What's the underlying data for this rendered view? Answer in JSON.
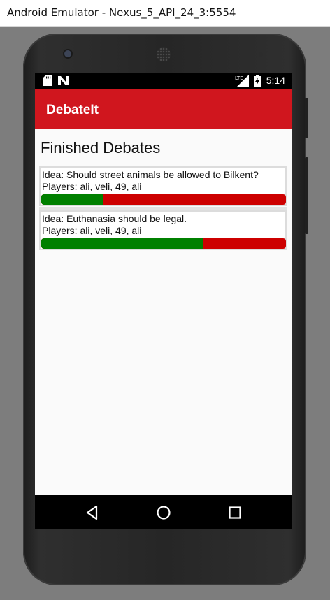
{
  "window": {
    "title": "Android Emulator - Nexus_5_API_24_3:5554"
  },
  "status_bar": {
    "time": "5:14",
    "network_label": "LTE",
    "icons": [
      "sd-card-icon",
      "n-notification-icon",
      "lte-signal-icon",
      "battery-charging-icon"
    ]
  },
  "app_bar": {
    "title": "DebateIt",
    "color": "#d0161e"
  },
  "page": {
    "title": "Finished Debates"
  },
  "debates": [
    {
      "idea": "Idea: Should street animals be allowed to Bilkent?",
      "players": "Players: ali, veli, 49, ali",
      "agree_fraction": 0.25
    },
    {
      "idea": "Idea: Euthanasia should be legal.",
      "players": "Players: ali, veli, 49, ali",
      "agree_fraction": 0.66
    }
  ],
  "colors": {
    "agree": "#008000",
    "disagree": "#cd0000"
  },
  "nav_bar": {
    "buttons": [
      "back-icon",
      "home-icon",
      "recents-icon"
    ]
  }
}
